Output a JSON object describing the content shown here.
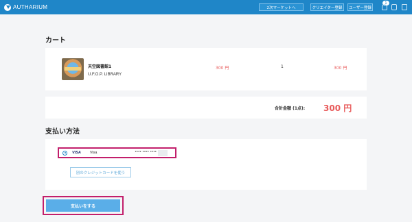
{
  "header": {
    "brand": "AUTHARIUM",
    "nav": {
      "market": "2次マーケットへ",
      "creator": "クリエイター登録",
      "user": "ユーザー登録"
    },
    "cart_count": "1"
  },
  "cart": {
    "heading": "カート",
    "items": [
      {
        "title": "天空図書館1",
        "author": "U.F.O.P. LIBRARY",
        "unit_price": "300 円",
        "quantity": "1",
        "subtotal": "300 円"
      }
    ],
    "total_label": "合計金額 (1点):",
    "total_value": "300 円"
  },
  "payment": {
    "heading": "支払い方法",
    "card_brand": "VISA",
    "card_name": "Visa",
    "card_number": "**** **** ****",
    "other_card_label": "別のクレジットカードを使う",
    "pay_button": "支払いをする"
  },
  "colors": {
    "brand_blue": "#1f86c8",
    "price_red": "#e85b5b",
    "highlight": "#c21e6b",
    "pay_button": "#5aaee8"
  }
}
